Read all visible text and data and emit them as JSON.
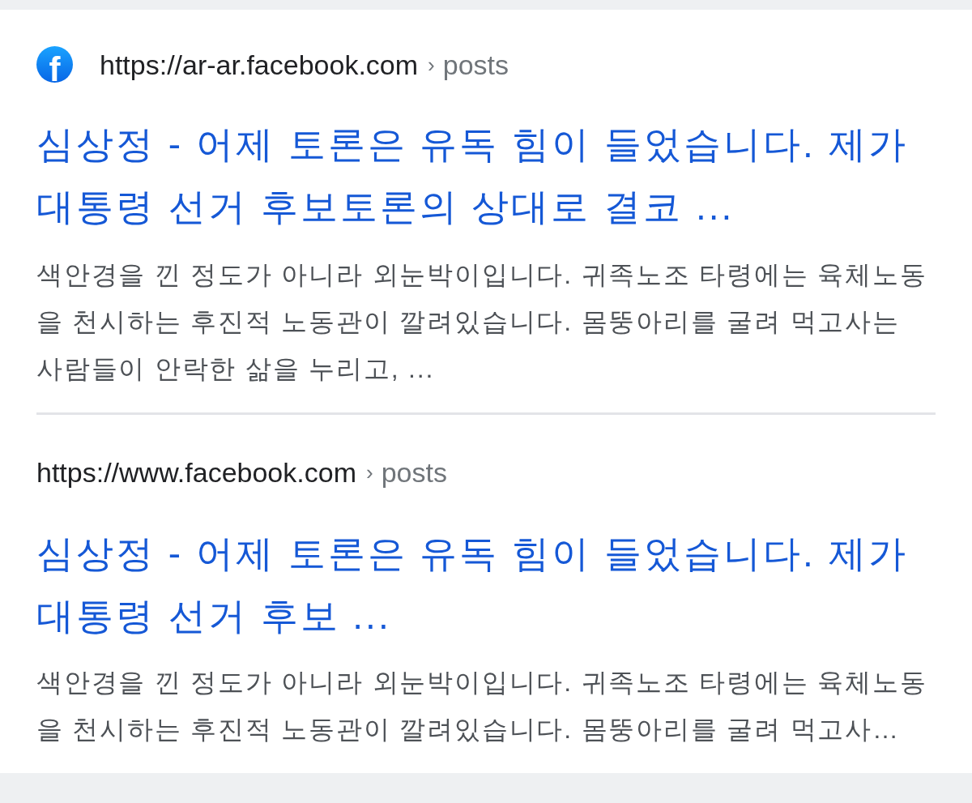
{
  "results": [
    {
      "favicon": {
        "letter": "f"
      },
      "url": "https://ar-ar.facebook.com",
      "separator": "›",
      "path": "posts",
      "title": "심상정 - 어제 토론은 유독 힘이 들었습니다. 제가 대통령 선거 후보토론의 상대로 결코 ...",
      "snippet": "색안경을 낀 정도가 아니라 외눈박이입니다. 귀족노조 타령에는 육체노동을 천시하는 후진적 노동관이 깔려있습니다. 몸뚱아리를 굴려 먹고사는 사람들이 안락한 삶을 누리고, ..."
    },
    {
      "url": "https://www.facebook.com",
      "separator": "›",
      "path": "posts",
      "title": "심상정 - 어제 토론은 유독 힘이 들었습니다. 제가 대통령 선거 후보 ...",
      "snippet": "색안경을 낀 정도가 아니라 외눈박이입니다. 귀족노조 타령에는 육체노동을 천시하는 후진적 노동관이 깔려있습니다. 몸뚱아리를 굴려 먹고사…"
    }
  ]
}
